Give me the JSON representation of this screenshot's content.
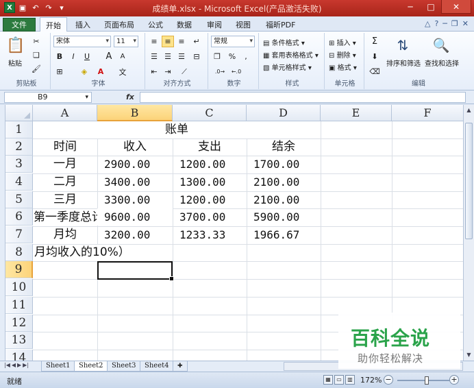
{
  "window": {
    "title": "成绩单.xlsx - Microsoft Excel(产品激活失败)",
    "controls": [
      "─",
      "□",
      "✕"
    ]
  },
  "ribbon_tabs": {
    "file": "文件",
    "items": [
      "开始",
      "插入",
      "页面布局",
      "公式",
      "数据",
      "审阅",
      "视图",
      "福昕PDF"
    ],
    "active": "开始"
  },
  "ribbon": {
    "clipboard": {
      "label": "剪贴板",
      "paste": "粘贴"
    },
    "font": {
      "label": "字体",
      "name": "宋体",
      "size": "11",
      "bold": "B",
      "italic": "I",
      "underline": "U",
      "grow": "A",
      "shrink": "A",
      "phonetic": "文"
    },
    "alignment": {
      "label": "对齐方式"
    },
    "number": {
      "label": "数字",
      "format": "常规",
      "percent": "%",
      "comma": ",",
      "currency": "❐"
    },
    "styles": {
      "label": "样式",
      "conditional": "条件格式",
      "table": "套用表格格式",
      "cell": "单元格样式"
    },
    "cells": {
      "label": "单元格",
      "insert": "插入",
      "delete": "删除",
      "format": "格式"
    },
    "editing": {
      "label": "编辑",
      "sort": "排序和筛选",
      "find": "查找和选择",
      "sum": "Σ"
    }
  },
  "formula_bar": {
    "name_box": "B9",
    "fx": "fx",
    "formula": ""
  },
  "columns": [
    "A",
    "B",
    "C",
    "D",
    "E",
    "F"
  ],
  "rows": [
    "1",
    "2",
    "3",
    "4",
    "5",
    "6",
    "7",
    "8",
    "9",
    "10",
    "11",
    "12",
    "13",
    "14"
  ],
  "selected_cell": "B9",
  "sheet": {
    "title": "账单",
    "headers": [
      "时间",
      "收入",
      "支出",
      "结余"
    ],
    "data_rows": [
      {
        "label": "一月",
        "income": "2900.00",
        "expense": "1200.00",
        "balance": "1700.00"
      },
      {
        "label": "二月",
        "income": "3400.00",
        "expense": "1300.00",
        "balance": "2100.00"
      },
      {
        "label": "三月",
        "income": "3300.00",
        "expense": "1200.00",
        "balance": "2100.00"
      },
      {
        "label": "第一季度总计",
        "income": "9600.00",
        "expense": "3700.00",
        "balance": "5900.00"
      },
      {
        "label": "月均",
        "income": "3200.00",
        "expense": "1233.33",
        "balance": "1966.67"
      }
    ],
    "note": "月均收入的10%）"
  },
  "sheet_tabs": [
    "Sheet1",
    "Sheet2",
    "Sheet3",
    "Sheet4"
  ],
  "active_sheet": "Sheet2",
  "status": {
    "ready": "就绪",
    "zoom": "172%"
  },
  "watermark": {
    "title": "百科全说",
    "subtitle": "助你轻松解决"
  },
  "colors": {
    "titlebar": "#b92d22",
    "file_tab": "#2c7a3e",
    "selection_header": "#fcd37a",
    "watermark": "#2aa34a"
  }
}
